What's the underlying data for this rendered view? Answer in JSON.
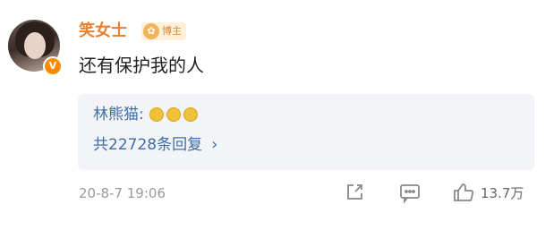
{
  "post": {
    "username": "笑女士",
    "badge_label": "博主",
    "verified_mark": "V",
    "comment_text": "还有保护我的人",
    "reply_preview": {
      "author": "林熊猫:",
      "emoji_icons": [
        "emoji-icon",
        "emoji-icon",
        "emoji-icon"
      ]
    },
    "reply_count_text": "共22728条回复",
    "reply_chevron": "›",
    "timestamp": "20-8-7 19:06",
    "actions": {
      "share_icon": "share-icon",
      "comment_icon": "comment-icon",
      "like_icon": "thumbs-up-icon",
      "like_count": "13.7万"
    }
  },
  "colors": {
    "username": "#e8802f",
    "link": "#3e6ea8",
    "reply_bg": "#f2f4f8",
    "muted": "#9a9a9a"
  }
}
